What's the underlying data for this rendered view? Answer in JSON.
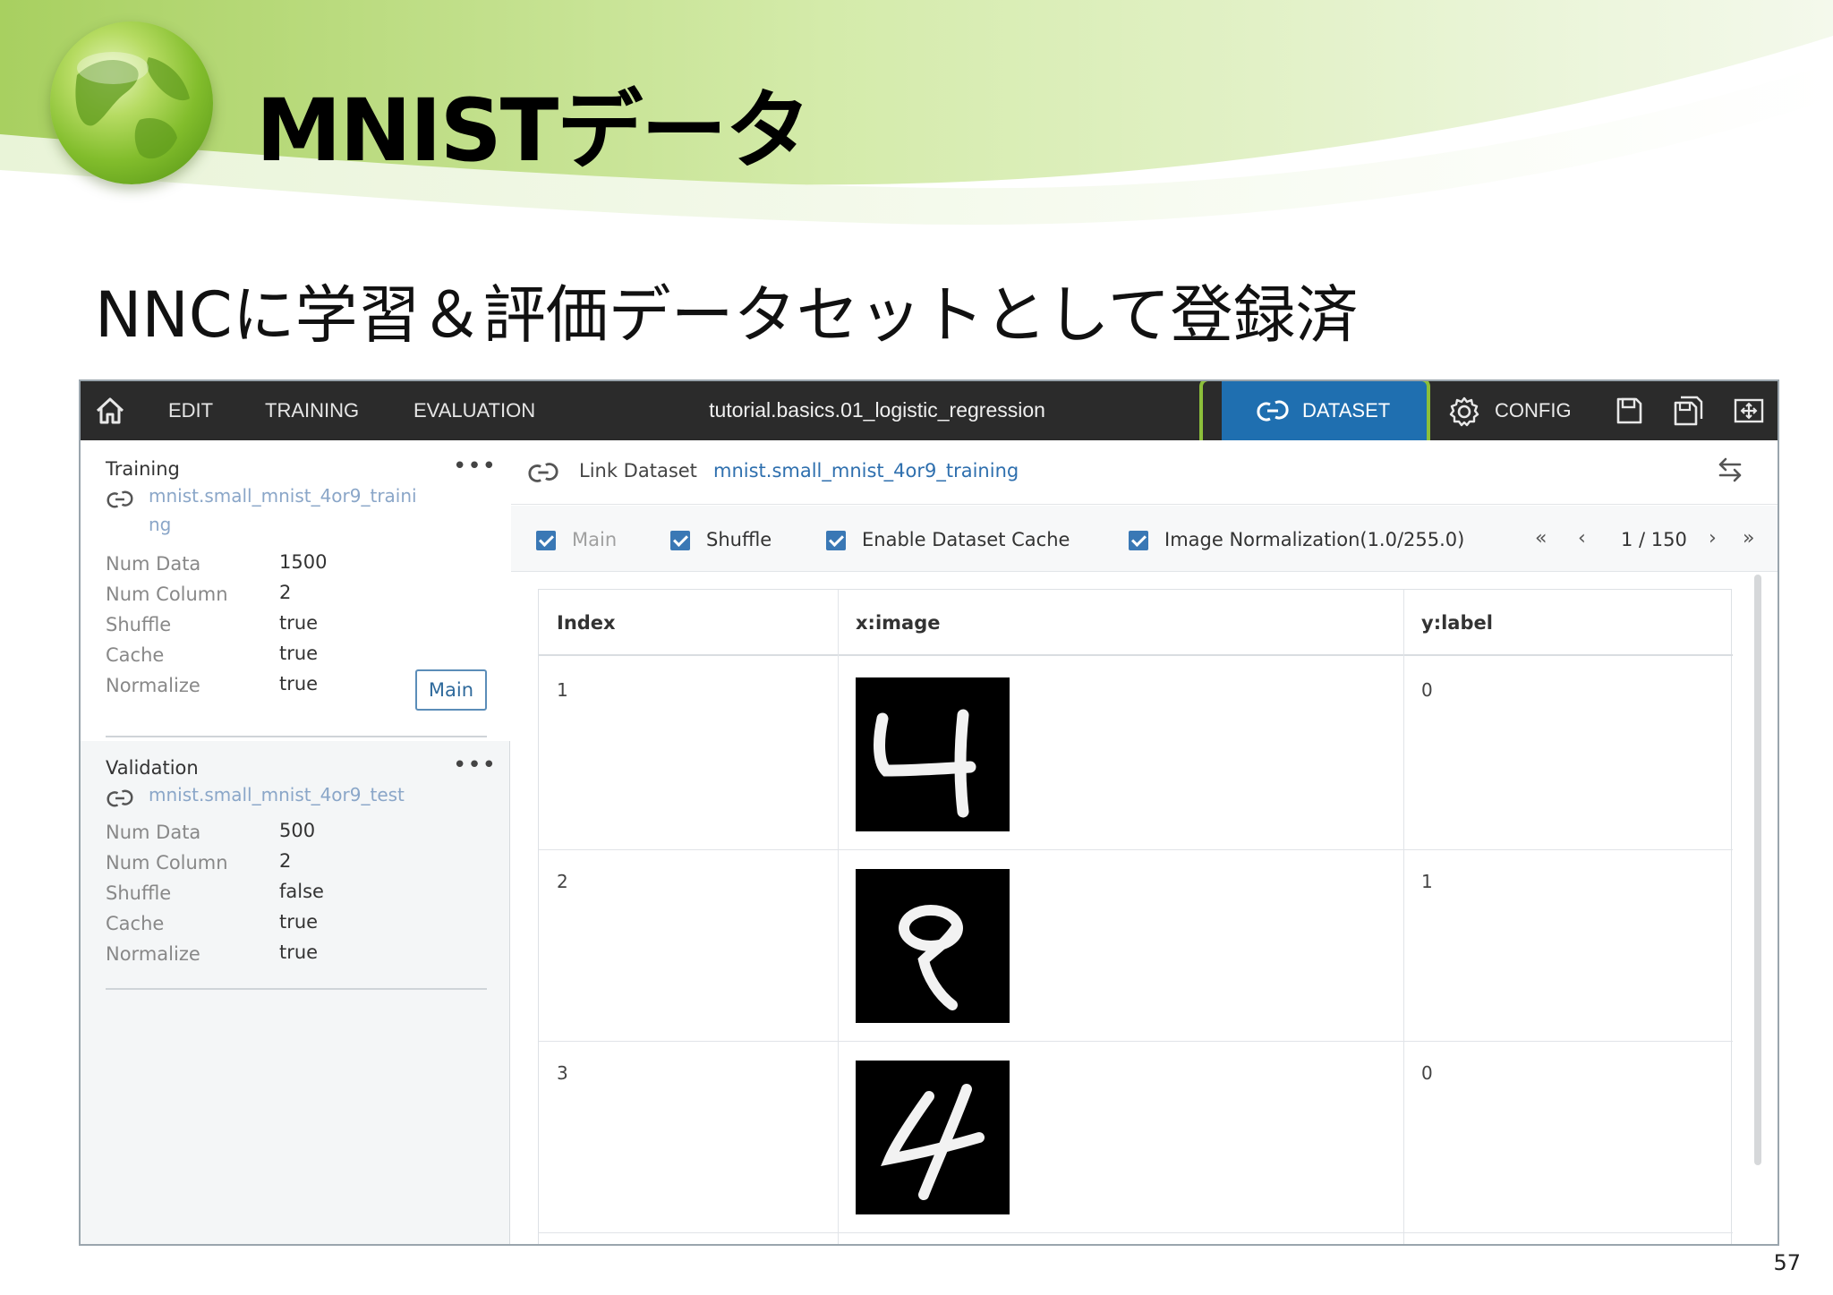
{
  "slide": {
    "title": "MNISTデータ",
    "subtitle": "NNCに学習＆評価データセットとして登録済",
    "page_number": "57"
  },
  "topbar": {
    "tabs": [
      "EDIT",
      "TRAINING",
      "EVALUATION"
    ],
    "project_name": "tutorial.basics.01_logistic_regression",
    "dataset_label": "DATASET",
    "config_label": "CONFIG"
  },
  "left_panel": {
    "training": {
      "title": "Training",
      "link_line1": "mnist.small_mnist_4or9_traini",
      "link_line2": "ng",
      "fields": [
        {
          "key": "Num Data",
          "value": "1500"
        },
        {
          "key": "Num Column",
          "value": "2"
        },
        {
          "key": "Shuffle",
          "value": "true"
        },
        {
          "key": "Cache",
          "value": "true"
        },
        {
          "key": "Normalize",
          "value": "true"
        }
      ],
      "main_button": "Main"
    },
    "validation": {
      "title": "Validation",
      "link": "mnist.small_mnist_4or9_test",
      "fields": [
        {
          "key": "Num Data",
          "value": "500"
        },
        {
          "key": "Num Column",
          "value": "2"
        },
        {
          "key": "Shuffle",
          "value": "false"
        },
        {
          "key": "Cache",
          "value": "true"
        },
        {
          "key": "Normalize",
          "value": "true"
        }
      ]
    }
  },
  "right_panel": {
    "link_label": "Link Dataset",
    "link_value": "mnist.small_mnist_4or9_training",
    "options": [
      {
        "label": "Main",
        "checked": true,
        "disabled": true
      },
      {
        "label": "Shuffle",
        "checked": true,
        "disabled": false
      },
      {
        "label": "Enable Dataset Cache",
        "checked": true,
        "disabled": false
      },
      {
        "label": "Image Normalization(1.0/255.0)",
        "checked": true,
        "disabled": false
      }
    ],
    "pager": {
      "text": "1 / 150",
      "current": 1,
      "total": 150
    },
    "table": {
      "headers": [
        "Index",
        "x:image",
        "y:label"
      ],
      "rows": [
        {
          "index": "1",
          "image": "digit-4",
          "label": "0"
        },
        {
          "index": "2",
          "image": "digit-9",
          "label": "1"
        },
        {
          "index": "3",
          "image": "digit-4",
          "label": "0"
        }
      ]
    }
  },
  "colors": {
    "topbar": "#2b2b2b",
    "dataset_active": "#1f6fb0",
    "highlight_border": "#8cbf3a",
    "link_text": "#2e6fae",
    "checkbox": "#3a78b5"
  }
}
